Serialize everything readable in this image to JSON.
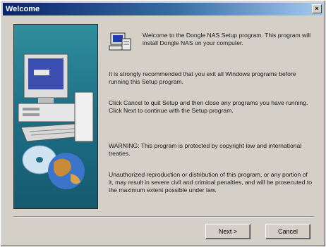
{
  "window": {
    "title": "Welcome",
    "close_glyph": "×"
  },
  "content": {
    "welcome": "Welcome to the Dongle NAS Setup program. This program will install Dongle NAS on your computer.",
    "recommend": "It is strongly recommended that you exit all Windows programs before running this Setup program.",
    "instructions": "Click Cancel to quit Setup and then close any programs you have running. Click Next to continue with the Setup program.",
    "warning": "WARNING: This program is protected by copyright law and international treaties.",
    "legal": "Unauthorized reproduction or distribution of this program, or any portion of it, may result in severe civil and criminal penalties, and will be prosecuted to the maximum extent possible under law."
  },
  "buttons": {
    "next_label": "Next >",
    "cancel_label": "Cancel"
  },
  "icons": {
    "setup": "setup-computer-icon",
    "side_art": "computer-cd-globe-illustration"
  },
  "colors": {
    "titlebar_start": "#0a246a",
    "titlebar_end": "#a6caf0",
    "dialog_bg": "#d4d0c8",
    "side_panel": "#1d6f86"
  }
}
